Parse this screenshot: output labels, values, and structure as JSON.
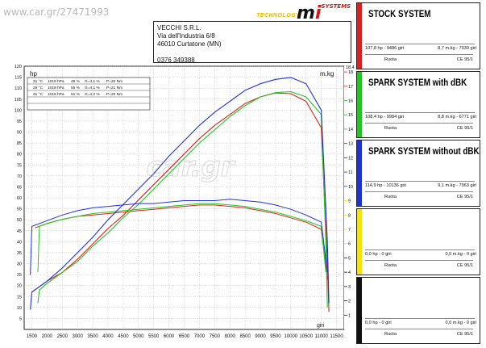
{
  "watermark": "www.car.gr/27471993",
  "logo": {
    "tagline": "TECHNOLOGY",
    "mark_prefix": "m",
    "mark_accent": "i",
    "mark_suffix": "SYSTEMS"
  },
  "address": {
    "lines": [
      "VECCHI S.R.L.",
      "Via dell'Industria 6/8",
      "46010 Curtatone (MN)",
      "",
      "0376 349388"
    ]
  },
  "chart_data": {
    "type": "line",
    "xlabel": "giri",
    "ylabel_left": "hp",
    "ylabel_right": "m.kg",
    "xlim": [
      1250,
      11750
    ],
    "xticks": [
      1500,
      2000,
      2500,
      3000,
      3500,
      4000,
      4500,
      5000,
      5500,
      6000,
      6500,
      7000,
      7500,
      8000,
      8500,
      9000,
      9500,
      10000,
      10500,
      11000,
      11500
    ],
    "ylim_left": [
      0,
      120
    ],
    "yticks_left": [
      5,
      10,
      15,
      20,
      25,
      30,
      35,
      40,
      45,
      50,
      55,
      60,
      65,
      70,
      75,
      80,
      85,
      90,
      95,
      100,
      105,
      110,
      115,
      120
    ],
    "ylim_right": [
      0,
      18.4
    ],
    "yticks_right": [
      1,
      2,
      3,
      4,
      5,
      6,
      7,
      8,
      9,
      10,
      11,
      12,
      13,
      14,
      15,
      16,
      17,
      18
    ],
    "yticks_right_top_label": "18,4",
    "grid": true,
    "conditions_table": [
      [
        "31 °C",
        "1019 hPa",
        "48 %",
        "G=4,1 %",
        "P=20 Nm"
      ],
      [
        "29 °C",
        "1018 hPa",
        "55 %",
        "G=4,1 %",
        "P=21 Nm"
      ],
      [
        "31 °C",
        "1018 hPa",
        "51 %",
        "G=4,2 %",
        "P=20 Nm"
      ]
    ],
    "series": [
      {
        "name": "STOCK SYSTEM",
        "color": "#e01e1e",
        "power_hp": [
          [
            1500,
            17
          ],
          [
            1600,
            18
          ],
          [
            2000,
            22
          ],
          [
            2500,
            26
          ],
          [
            3000,
            32
          ],
          [
            3500,
            39
          ],
          [
            4000,
            46
          ],
          [
            4500,
            52
          ],
          [
            5000,
            59
          ],
          [
            5500,
            66
          ],
          [
            6000,
            73
          ],
          [
            6500,
            80
          ],
          [
            7000,
            87
          ],
          [
            7500,
            93
          ],
          [
            8000,
            98
          ],
          [
            8500,
            103
          ],
          [
            9000,
            106
          ],
          [
            9500,
            107.8
          ],
          [
            10000,
            107.5
          ],
          [
            10500,
            104
          ],
          [
            11000,
            92
          ],
          [
            11200,
            30
          ],
          [
            11250,
            8
          ]
        ],
        "torque_mkg": [
          [
            1600,
            7.1
          ],
          [
            2000,
            7.4
          ],
          [
            2500,
            7.7
          ],
          [
            3000,
            7.9
          ],
          [
            3500,
            8.0
          ],
          [
            4000,
            8.1
          ],
          [
            4500,
            8.2
          ],
          [
            5000,
            8.3
          ],
          [
            5500,
            8.4
          ],
          [
            6000,
            8.5
          ],
          [
            6500,
            8.6
          ],
          [
            7000,
            8.7
          ],
          [
            7500,
            8.7
          ],
          [
            8000,
            8.6
          ],
          [
            8500,
            8.5
          ],
          [
            9000,
            8.3
          ],
          [
            9500,
            8.1
          ],
          [
            10000,
            7.8
          ],
          [
            10500,
            7.5
          ],
          [
            11000,
            7.0
          ],
          [
            11200,
            3.5
          ]
        ]
      },
      {
        "name": "SPARK SYSTEM with dBK",
        "color": "#1ec81e",
        "power_hp": [
          [
            1700,
            12
          ],
          [
            1750,
            18
          ],
          [
            2000,
            21
          ],
          [
            2500,
            26
          ],
          [
            3000,
            31
          ],
          [
            3500,
            38
          ],
          [
            4000,
            44
          ],
          [
            4500,
            51
          ],
          [
            5000,
            57
          ],
          [
            5500,
            64
          ],
          [
            6000,
            71
          ],
          [
            6500,
            78
          ],
          [
            7000,
            85
          ],
          [
            7500,
            91
          ],
          [
            8000,
            97
          ],
          [
            8500,
            102
          ],
          [
            9000,
            106
          ],
          [
            9500,
            108
          ],
          [
            10000,
            108.4
          ],
          [
            10500,
            106
          ],
          [
            11000,
            98
          ],
          [
            11150,
            40
          ],
          [
            11200,
            10
          ]
        ],
        "torque_mkg": [
          [
            1700,
            4.0
          ],
          [
            1750,
            7.2
          ],
          [
            2000,
            7.4
          ],
          [
            2500,
            7.7
          ],
          [
            3000,
            7.9
          ],
          [
            3500,
            8.1
          ],
          [
            4000,
            8.2
          ],
          [
            4500,
            8.3
          ],
          [
            5000,
            8.4
          ],
          [
            5500,
            8.5
          ],
          [
            6000,
            8.6
          ],
          [
            6500,
            8.7
          ],
          [
            7000,
            8.8
          ],
          [
            7500,
            8.8
          ],
          [
            8000,
            8.7
          ],
          [
            8500,
            8.6
          ],
          [
            9000,
            8.4
          ],
          [
            9500,
            8.2
          ],
          [
            10000,
            7.9
          ],
          [
            10500,
            7.6
          ],
          [
            11000,
            7.2
          ],
          [
            11150,
            4.0
          ]
        ]
      },
      {
        "name": "SPARK SYSTEM without dBK",
        "color": "#1e32dc",
        "power_hp": [
          [
            1450,
            9
          ],
          [
            1500,
            17
          ],
          [
            2000,
            22
          ],
          [
            2500,
            28
          ],
          [
            3000,
            35
          ],
          [
            3500,
            42
          ],
          [
            4000,
            50
          ],
          [
            4500,
            57
          ],
          [
            5000,
            64
          ],
          [
            5500,
            71
          ],
          [
            6000,
            79
          ],
          [
            6500,
            86
          ],
          [
            7000,
            93
          ],
          [
            7500,
            99
          ],
          [
            8000,
            104
          ],
          [
            8500,
            109
          ],
          [
            9000,
            112
          ],
          [
            9500,
            114
          ],
          [
            10000,
            114.9
          ],
          [
            10500,
            112
          ],
          [
            11000,
            100
          ],
          [
            11200,
            40
          ],
          [
            11250,
            12
          ]
        ],
        "torque_mkg": [
          [
            1450,
            3.8
          ],
          [
            1500,
            7.2
          ],
          [
            2000,
            7.6
          ],
          [
            2500,
            8.0
          ],
          [
            3000,
            8.3
          ],
          [
            3500,
            8.5
          ],
          [
            4000,
            8.6
          ],
          [
            4500,
            8.7
          ],
          [
            5000,
            8.8
          ],
          [
            5500,
            8.8
          ],
          [
            6000,
            8.9
          ],
          [
            6500,
            9.0
          ],
          [
            7000,
            9.0
          ],
          [
            7500,
            9.0
          ],
          [
            8000,
            9.1
          ],
          [
            8500,
            9.0
          ],
          [
            9000,
            8.9
          ],
          [
            9500,
            8.7
          ],
          [
            10000,
            8.4
          ],
          [
            10500,
            8.0
          ],
          [
            11000,
            7.5
          ],
          [
            11200,
            4.0
          ]
        ]
      }
    ]
  },
  "panels": [
    {
      "title": "STOCK SYSTEM",
      "color": "#e01e1e",
      "values_left": "107,8 hp - 9486 giri",
      "values_right": "8,7 m.kg - 7939 giri",
      "foot_left": "Ruota",
      "foot_right": "CE 95/1"
    },
    {
      "title": "SPARK SYSTEM with dBK",
      "color": "#1ec81e",
      "values_left": "108,4 hp - 9984 giri",
      "values_right": "8,8 m.kg - 6771 giri",
      "foot_left": "Ruota",
      "foot_right": "CE 95/1"
    },
    {
      "title": "SPARK SYSTEM without dBK",
      "color": "#1e32dc",
      "values_left": "114,9 hp - 10136 giri",
      "values_right": "9,1 m.kg - 7963 giri",
      "foot_left": "Ruota",
      "foot_right": "CE 95/1"
    },
    {
      "title": "",
      "color": "#f5e400",
      "values_left": "0,0 hp - 0 giri",
      "values_right": "0,0 m.kg - 0 giri",
      "foot_left": "Ruota",
      "foot_right": "CE 95/1"
    },
    {
      "title": "",
      "color": "#111111",
      "values_left": "0,0 hp - 0 giri",
      "values_right": "0,0 m.kg - 0 giri",
      "foot_left": "Ruota",
      "foot_right": "CE 95/1"
    }
  ],
  "center_watermark": "car.gr"
}
